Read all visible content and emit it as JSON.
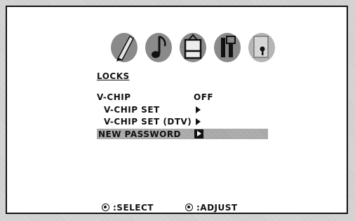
{
  "menu_icons": [
    "paintbrush-icon",
    "music-note-icon",
    "tv-setup-icon",
    "tools-icon",
    "lock-icon"
  ],
  "section": {
    "title": "LOCKS"
  },
  "items": [
    {
      "label": "V-CHIP",
      "value": "OFF"
    },
    {
      "label": "V-CHIP SET"
    },
    {
      "label": "V-CHIP SET (DTV)"
    },
    {
      "label": "NEW PASSWORD",
      "selected": true
    }
  ],
  "footer": {
    "select_label": ":SELECT",
    "adjust_label": ":ADJUST"
  }
}
